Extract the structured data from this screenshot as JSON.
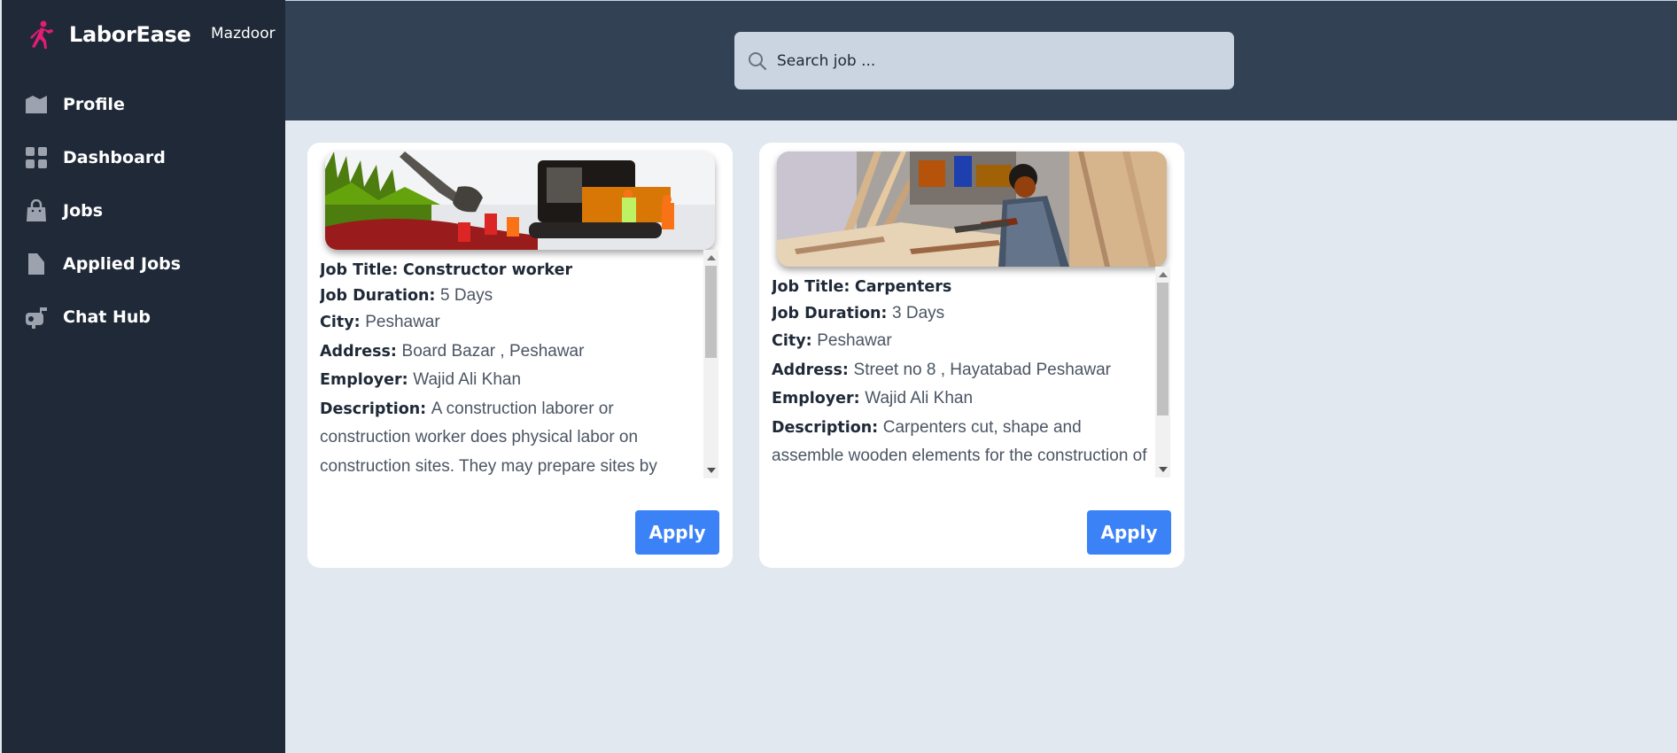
{
  "brand": {
    "name": "LaborEase",
    "role": "Mazdoor"
  },
  "sidebar": {
    "items": [
      {
        "label": "Profile",
        "icon": "profile-icon"
      },
      {
        "label": "Dashboard",
        "icon": "dashboard-icon"
      },
      {
        "label": "Jobs",
        "icon": "jobs-bag-icon"
      },
      {
        "label": "Applied Jobs",
        "icon": "applied-jobs-icon"
      },
      {
        "label": "Chat Hub",
        "icon": "chat-hub-icon"
      }
    ]
  },
  "search": {
    "placeholder": "Search job ...",
    "value": ""
  },
  "field_labels": {
    "title": "Job Title:",
    "duration": "Job Duration:",
    "city": "City:",
    "address": "Address:",
    "employer": "Employer:",
    "description": "Description:"
  },
  "jobs": [
    {
      "title": "Constructor worker",
      "duration": "5 Days",
      "city": "Peshawar",
      "address": "Board Bazar , Peshawar",
      "employer": "Wajid Ali Khan",
      "description": "A construction laborer or construction worker does physical labor on construction sites. They may prepare sites by",
      "image": "construction-site-photo",
      "apply_label": "Apply"
    },
    {
      "title": "Carpenters",
      "duration": "3 Days",
      "city": "Peshawar",
      "address": "Street no 8 , Hayatabad Peshawar",
      "employer": "Wajid Ali Khan",
      "description": "Carpenters cut, shape and assemble wooden elements for the construction of buildings and other structures. They also use materials such",
      "image": "carpenter-workshop-photo",
      "apply_label": "Apply"
    }
  ],
  "colors": {
    "sidebar_bg": "#1f2937",
    "header_bg": "#334155",
    "page_bg": "#e2e8f0",
    "accent": "#3b82f6",
    "logo": "#e11d74"
  }
}
